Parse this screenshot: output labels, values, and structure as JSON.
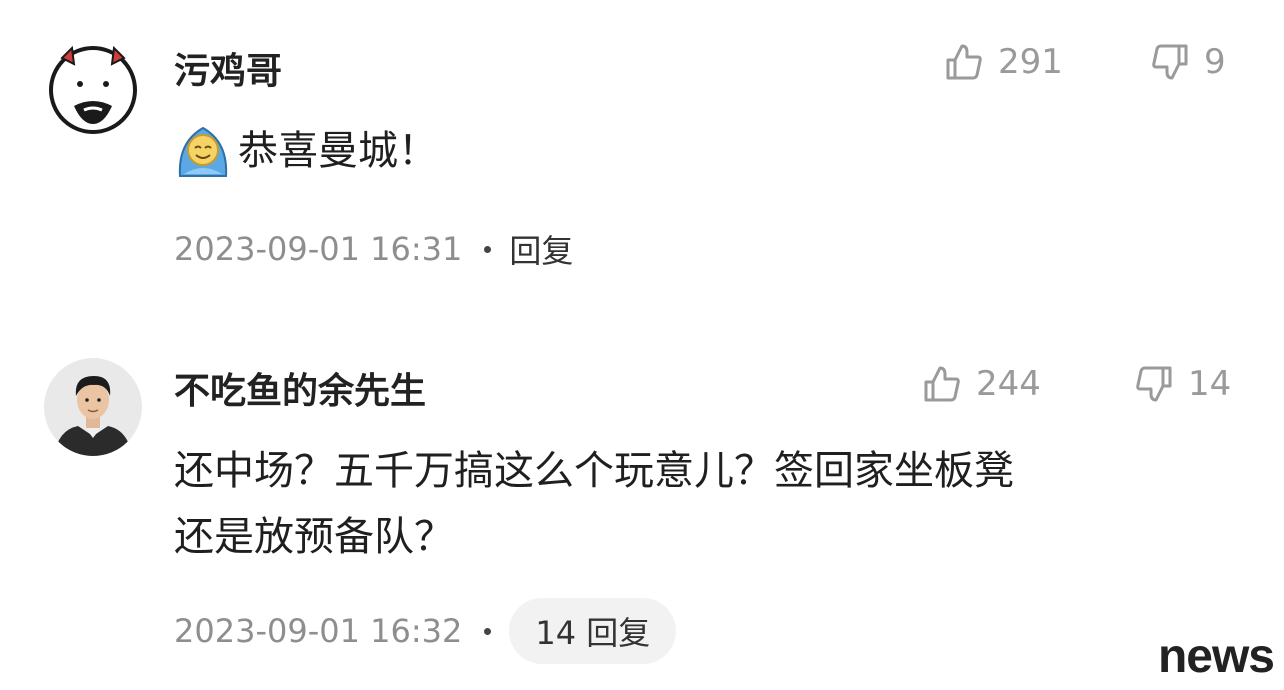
{
  "comments": [
    {
      "username": "污鸡哥",
      "avatar_icon": "cartoon-face-avatar",
      "likes": "291",
      "dislikes": "9",
      "emoji_icon": "blanket-emoji-icon",
      "text": "恭喜曼城！",
      "timestamp": "2023-09-01 16:31",
      "reply_label": "回复"
    },
    {
      "username": "不吃鱼的余先生",
      "avatar_icon": "man-photo-avatar",
      "likes": "244",
      "dislikes": "14",
      "text_line1": "还中场？五千万搞这么个玩意儿？签回家坐板凳",
      "text_line2": "还是放预备队？",
      "timestamp": "2023-09-01 16:32",
      "reply_label": "14 回复"
    }
  ],
  "watermark": "news",
  "colors": {
    "text_primary": "#1f1f1f",
    "text_secondary": "#8e8e8e",
    "icon_gray": "#9a9a9a",
    "pill_bg": "#f2f2f2"
  }
}
